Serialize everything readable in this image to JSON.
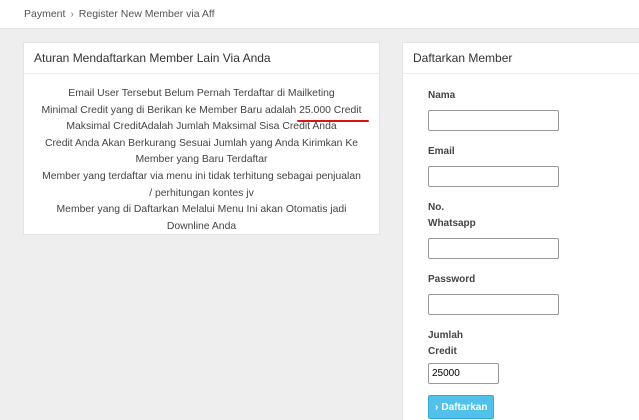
{
  "breadcrumb": {
    "parent": "Payment",
    "separator": "›",
    "current": "Register New Member via Aff"
  },
  "rules_card": {
    "title": "Aturan Mendaftarkan Member Lain Via Anda",
    "line1": "Email User Tersebut Belum Pernah Terdaftar di Mailketing",
    "line2_prefix": "Minimal Credit yang di Berikan ke Member Baru adalah ",
    "line2_highlight": "25.000 Credit",
    "line3": "Maksimal CreditAdalah Jumlah Maksimal Sisa Credit Anda",
    "line4a": "Credit Anda Akan Berkurang Sesuai Jumlah yang Anda Kirimkan Ke",
    "line4b": "Member yang Baru Terdaftar",
    "line5a": "Member yang terdaftar via menu ini tidak terhitung sebagai penjualan",
    "line5b": "/ perhitungan kontes jv",
    "line6a": "Member yang di Daftarkan Melalui Menu Ini akan Otomatis jadi",
    "line6b": "Downline Anda",
    "highlight_color": "#dd1111"
  },
  "register_card": {
    "title": "Daftarkan Member",
    "name_label": "Nama",
    "name_value": "",
    "email_label": "Email",
    "email_value": "",
    "whatsapp_label_1": "No.",
    "whatsapp_label_2": "Whatsapp",
    "whatsapp_value": "",
    "password_label": "Password",
    "password_value": "",
    "credit_label_1": "Jumlah",
    "credit_label_2": "Credit",
    "credit_value": "25000",
    "submit_label": "Daftarkan",
    "submit_icon": "chevron-right-icon",
    "submit_color": "#4fc1ea"
  }
}
